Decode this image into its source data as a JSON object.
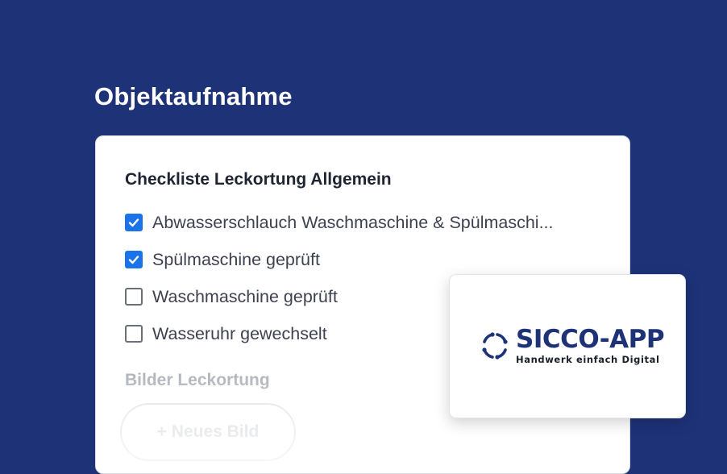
{
  "header": {
    "title": "Objektaufnahme"
  },
  "checklist": {
    "title": "Checkliste Leckortung Allgemein",
    "items": [
      {
        "label": "Abwasserschlauch Waschmaschine & Spülmaschi...",
        "checked": true
      },
      {
        "label": "Spülmaschine geprüft",
        "checked": true
      },
      {
        "label": "Waschmaschine geprüft",
        "checked": false
      },
      {
        "label": "Wasseruhr gewechselt",
        "checked": false
      }
    ]
  },
  "images_section": {
    "title": "Bilder Leckortung",
    "add_button_label": "+ Neues Bild"
  },
  "logo": {
    "name": "SICCO-APP",
    "tagline": "Handwerk einfach Digital",
    "icon": "circular-arrows-logo-icon"
  },
  "colors": {
    "background": "#1e3278",
    "checkbox_checked": "#1a73e8",
    "brand": "#1e3278"
  }
}
